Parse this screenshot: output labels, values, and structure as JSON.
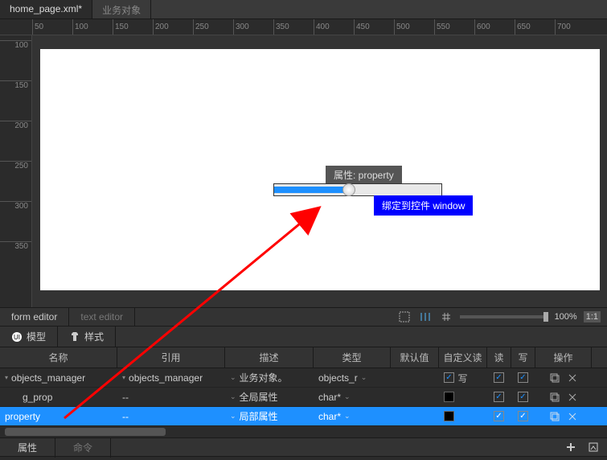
{
  "file_tabs": {
    "active": "home_page.xml*",
    "inactive": "业务对象"
  },
  "ruler_h": [
    "50",
    "100",
    "150",
    "200",
    "250",
    "300",
    "350",
    "400",
    "450",
    "500",
    "550",
    "600",
    "650",
    "700"
  ],
  "ruler_v": [
    "100",
    "150",
    "200",
    "250",
    "300",
    "350"
  ],
  "canvas_widget": {
    "prop_label": "属性: property",
    "bind_label": "绑定到控件 window"
  },
  "switch": {
    "form": "form editor",
    "text": "text editor",
    "zoom": "100%",
    "ratio": "1:1"
  },
  "inspector_tabs": {
    "model": "模型",
    "style": "样式"
  },
  "columns": {
    "name": "名称",
    "ref": "引用",
    "desc": "描述",
    "type": "类型",
    "def": "默认值",
    "crw": "自定义读写",
    "r": "读",
    "w": "写",
    "op": "操作"
  },
  "rows": [
    {
      "indent": 0,
      "expander": "▾",
      "name": "objects_manager",
      "ref_expander": "▾",
      "ref": "objects_manager",
      "desc_chev": true,
      "desc": "业务对象。",
      "type": "objects_r",
      "type_chev": true,
      "def": "",
      "crw_box": false,
      "r": true,
      "w": true
    },
    {
      "indent": 1,
      "expander": "",
      "name": "g_prop",
      "ref_expander": "",
      "ref": "--",
      "desc_chev": true,
      "desc": "全局属性",
      "type": "char*",
      "type_chev": true,
      "def": "",
      "crw_box": true,
      "r": true,
      "w": true
    },
    {
      "indent": 0,
      "expander": "",
      "name": "property",
      "ref_expander": "",
      "ref": "--",
      "desc_chev": true,
      "desc": "局部属性",
      "type": "char*",
      "type_chev": true,
      "def": "",
      "crw_box": true,
      "r": true,
      "w": true,
      "selected": true
    }
  ],
  "bottom_tabs": {
    "attr": "属性",
    "cmd": "命令"
  }
}
